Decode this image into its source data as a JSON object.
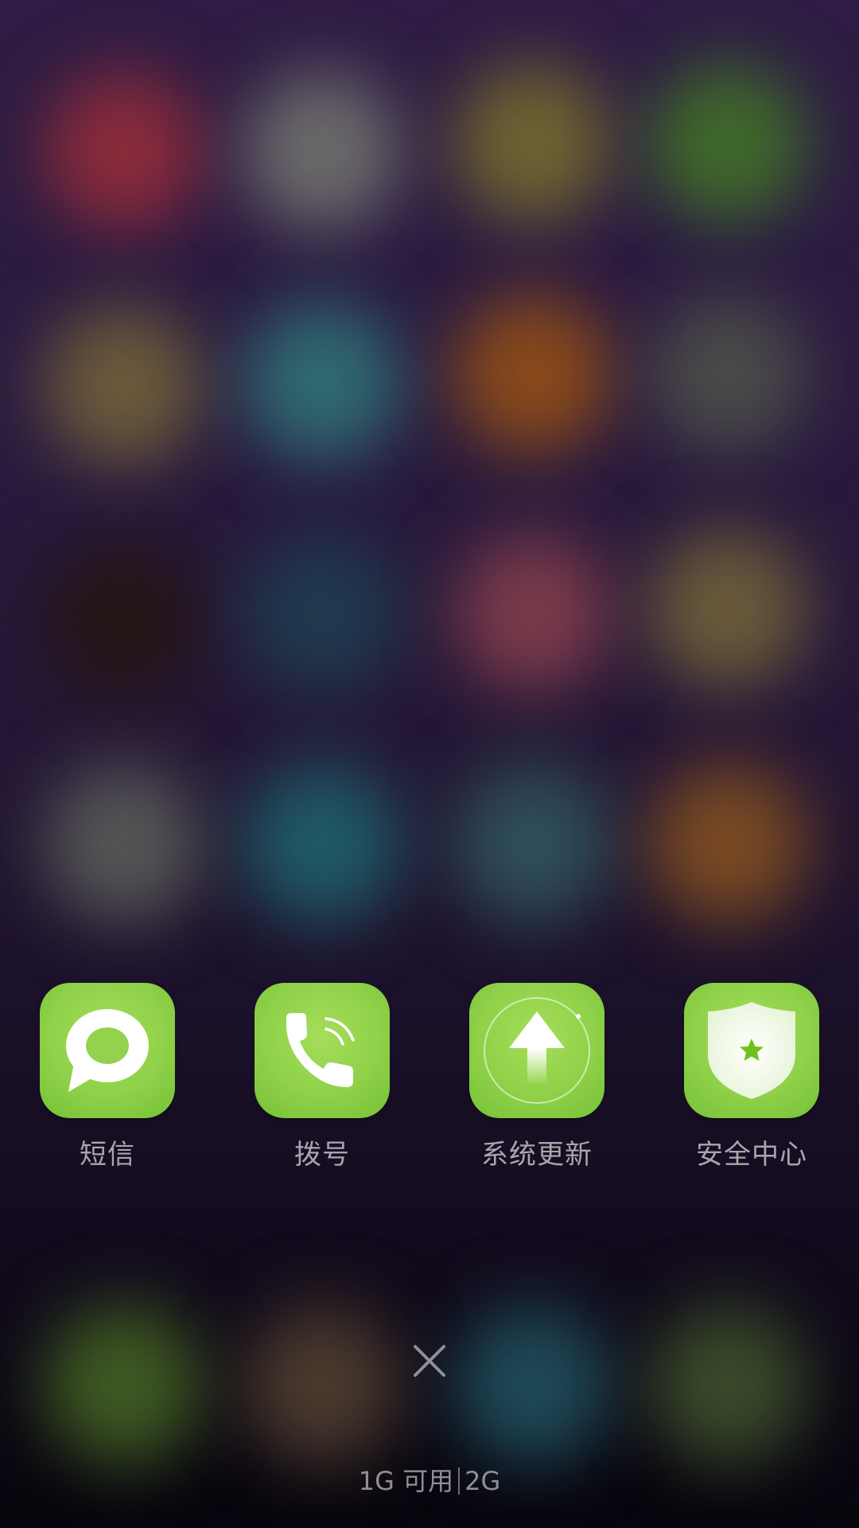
{
  "background_blobs": [
    {
      "color": "#8a2b3a"
    },
    {
      "color": "#6b6a6a"
    },
    {
      "color": "#6e6330"
    },
    {
      "color": "#3f6a2a"
    },
    {
      "color": "#6b5a3a"
    },
    {
      "color": "#2f6a72"
    },
    {
      "color": "#8a4a1a"
    },
    {
      "color": "#4a4a48"
    },
    {
      "color": "#241616"
    },
    {
      "color": "#1f3a4e"
    },
    {
      "color": "#7a3a4a"
    },
    {
      "color": "#6a5a3a"
    },
    {
      "color": "#555555"
    },
    {
      "color": "#1f5a66"
    },
    {
      "color": "#2f4f5a"
    },
    {
      "color": "#7a4a22"
    },
    {
      "color": "#3f5a22"
    },
    {
      "color": "#4a3a2e"
    },
    {
      "color": "#1f4a58"
    },
    {
      "color": "#3a4a2a"
    }
  ],
  "apps": [
    {
      "label": "短信",
      "icon": "message-bubble-icon"
    },
    {
      "label": "拨号",
      "icon": "phone-handset-icon"
    },
    {
      "label": "系统更新",
      "icon": "update-arrow-icon"
    },
    {
      "label": "安全中心",
      "icon": "security-shield-icon"
    }
  ],
  "close_icon": "close-icon",
  "memory": {
    "available": "1G 可用",
    "total": "2G"
  },
  "colors": {
    "tile_green": "#8fd149",
    "label_gray": "#a7a7ad",
    "star_green": "#6fc21a"
  }
}
